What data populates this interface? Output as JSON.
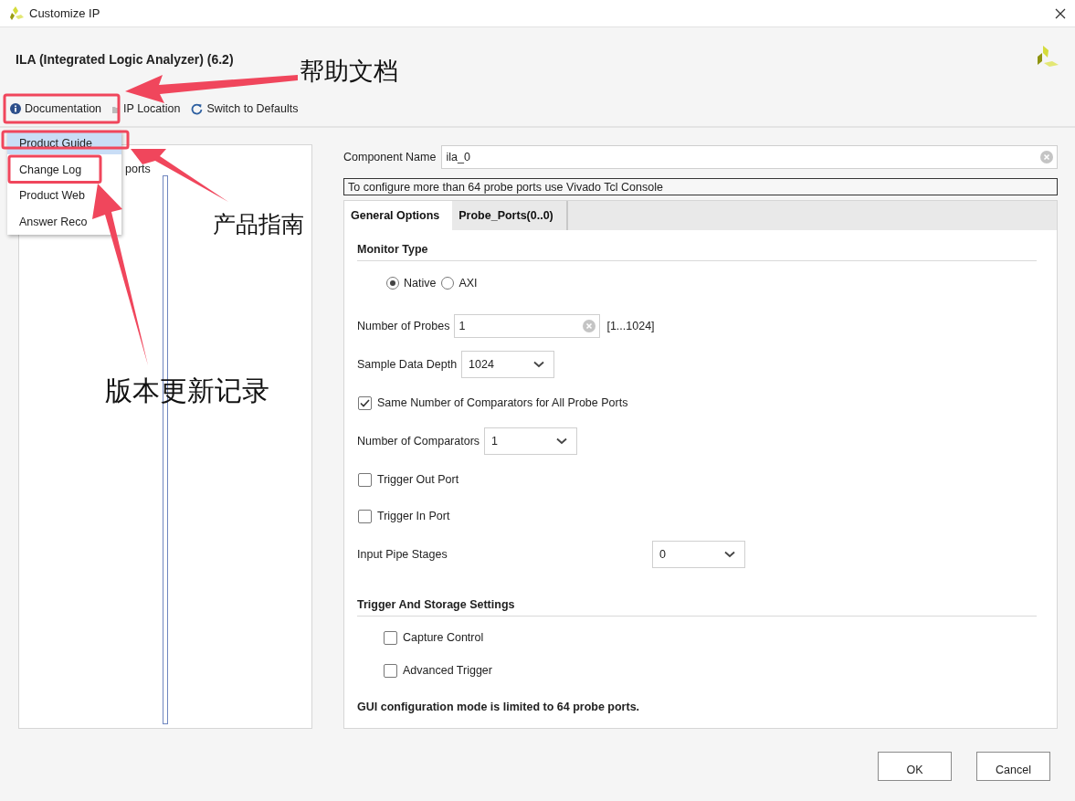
{
  "window": {
    "title": "Customize IP"
  },
  "header": {
    "title": "ILA (Integrated Logic Analyzer) (6.2)"
  },
  "toolbar": [
    {
      "label": "Documentation",
      "kind": "info"
    },
    {
      "label": "IP Location",
      "kind": "folder"
    },
    {
      "label": "Switch to Defaults",
      "kind": "refresh"
    }
  ],
  "documentation_menu": [
    {
      "label": "Product Guide",
      "selected": true
    },
    {
      "label": "Change Log",
      "selected": false
    },
    {
      "label": "Product Web",
      "selected": false
    },
    {
      "label": "Answer Reco",
      "selected": false
    }
  ],
  "left_panel": {
    "text": "ports"
  },
  "component_name": {
    "label": "Component Name",
    "value": "ila_0"
  },
  "notice": "To configure more than 64 probe ports use Vivado Tcl Console",
  "tabs": [
    {
      "label": "General Options",
      "selected": true
    },
    {
      "label": "Probe_Ports(0..0)",
      "selected": false
    }
  ],
  "sections": [
    {
      "title": "Monitor Type",
      "rows": [
        {
          "kind": "radio",
          "options": [
            {
              "label": "Native",
              "selected": true
            },
            {
              "label": "AXI",
              "selected": false
            }
          ]
        },
        {
          "kind": "text",
          "label": "Number of Probes",
          "value": "1",
          "range": "[1...1024]"
        },
        {
          "kind": "select",
          "label": "Sample Data Depth",
          "value": "1024"
        },
        {
          "kind": "checkbox",
          "label": "Same Number of Comparators for All Probe Ports",
          "checked": true
        },
        {
          "kind": "select",
          "label": "Number of Comparators",
          "value": "1"
        },
        {
          "kind": "checkbox",
          "label": "Trigger Out Port",
          "checked": false
        },
        {
          "kind": "checkbox",
          "label": "Trigger In Port",
          "checked": false
        },
        {
          "kind": "aligned-select",
          "label": "Input Pipe Stages",
          "value": "0"
        }
      ]
    },
    {
      "title": "Trigger And Storage Settings",
      "rows": [
        {
          "kind": "sub-checkbox",
          "label": "Capture Control",
          "checked": false
        },
        {
          "kind": "sub-checkbox",
          "label": "Advanced Trigger",
          "checked": false
        }
      ]
    }
  ],
  "footnote": "GUI configuration mode is limited to 64 probe ports.",
  "buttons": [
    {
      "label": "OK"
    },
    {
      "label": "Cancel"
    }
  ],
  "annotations": [
    {
      "text": "帮助文档"
    },
    {
      "text": "产品指南"
    },
    {
      "text": "版本更新记录"
    }
  ]
}
